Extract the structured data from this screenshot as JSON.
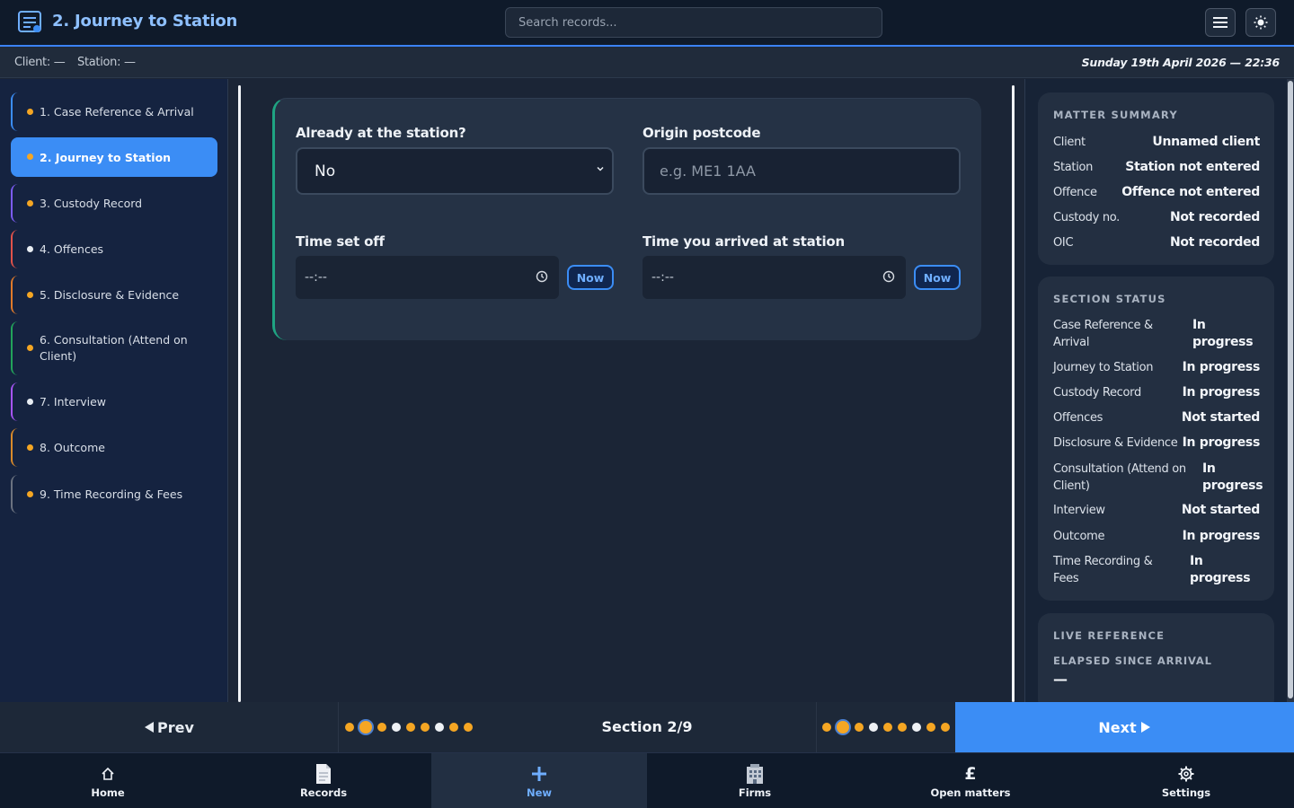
{
  "header": {
    "title": "2. Journey to Station",
    "search_placeholder": "Search records..."
  },
  "context": {
    "client": "Client: —",
    "station": "Station: —",
    "date": "Sunday 19th April 2026 — 22:36"
  },
  "sidebar": {
    "items": [
      {
        "label": "1. Case Reference & Arrival",
        "status": "in-progress"
      },
      {
        "label": "2. Journey to Station",
        "status": "in-progress"
      },
      {
        "label": "3. Custody Record",
        "status": "in-progress"
      },
      {
        "label": "4. Offences",
        "status": "not-started"
      },
      {
        "label": "5. Disclosure & Evidence",
        "status": "in-progress"
      },
      {
        "label": "6. Consultation (Attend on Client)",
        "status": "in-progress"
      },
      {
        "label": "7. Interview",
        "status": "not-started"
      },
      {
        "label": "8. Outcome",
        "status": "in-progress"
      },
      {
        "label": "9. Time Recording & Fees",
        "status": "in-progress"
      }
    ]
  },
  "form": {
    "already_label": "Already at the station?",
    "already_value": "No",
    "origin_label": "Origin postcode",
    "origin_placeholder": "e.g. ME1 1AA",
    "setoff_label": "Time set off",
    "setoff_value": "--:--",
    "arrived_label": "Time you arrived at station",
    "arrived_value": "--:--",
    "now_label": "Now"
  },
  "summary": {
    "title": "MATTER SUMMARY",
    "rows": [
      {
        "k": "Client",
        "v": "Unnamed client"
      },
      {
        "k": "Station",
        "v": "Station not entered"
      },
      {
        "k": "Offence",
        "v": "Offence not entered"
      },
      {
        "k": "Custody no.",
        "v": "Not recorded"
      },
      {
        "k": "OIC",
        "v": "Not recorded"
      }
    ]
  },
  "status": {
    "title": "SECTION STATUS",
    "rows": [
      {
        "k": "Case Reference & Arrival",
        "v": "In progress"
      },
      {
        "k": "Journey to Station",
        "v": "In progress"
      },
      {
        "k": "Custody Record",
        "v": "In progress"
      },
      {
        "k": "Offences",
        "v": "Not started"
      },
      {
        "k": "Disclosure & Evidence",
        "v": "In progress"
      },
      {
        "k": "Consultation (Attend on Client)",
        "v": "In progress"
      },
      {
        "k": "Interview",
        "v": "Not started"
      },
      {
        "k": "Outcome",
        "v": "In progress"
      },
      {
        "k": "Time Recording & Fees",
        "v": "In progress"
      }
    ]
  },
  "live": {
    "title": "LIVE REFERENCE",
    "subtitle": "ELAPSED SINCE ARRIVAL",
    "value": "—"
  },
  "footer": {
    "prev": "Prev",
    "next": "Next",
    "section": "Section 2/9"
  },
  "tabs": [
    {
      "label": "Home",
      "icon": "home-icon"
    },
    {
      "label": "Records",
      "icon": "document-icon"
    },
    {
      "label": "New",
      "icon": "plus-icon"
    },
    {
      "label": "Firms",
      "icon": "building-icon"
    },
    {
      "label": "Open matters",
      "icon": "pound-icon"
    },
    {
      "label": "Settings",
      "icon": "gear-icon"
    }
  ],
  "colors": {
    "accent": "#3b8df5",
    "in_progress_dot": "#f5a623",
    "not_started_dot": "#e8edf3",
    "card_border": "#1fa482"
  }
}
